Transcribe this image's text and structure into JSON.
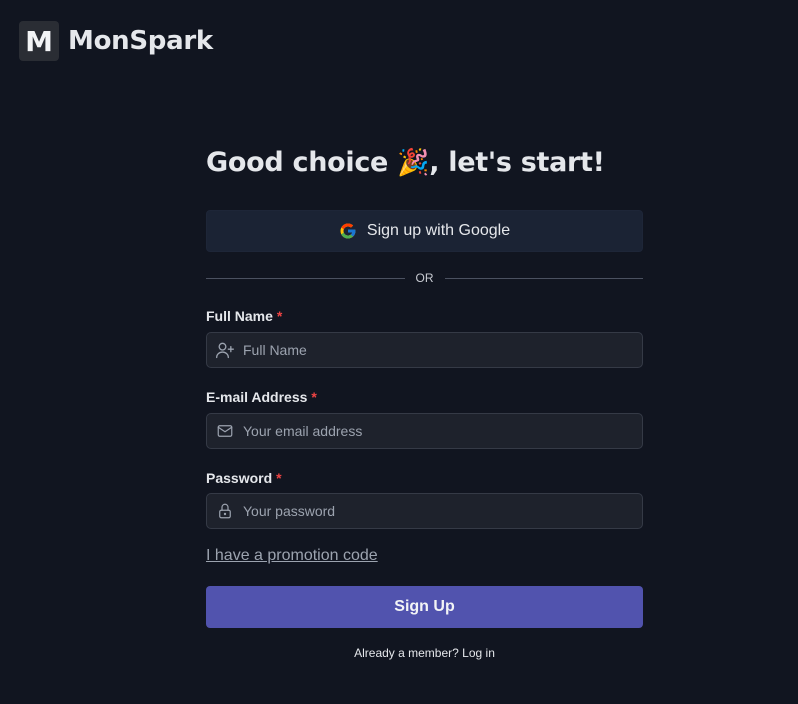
{
  "brand": {
    "mark": "M",
    "name": "MonSpark"
  },
  "heading": {
    "before": "Good choice",
    "emoji": "🎉",
    "after": ", let's start!"
  },
  "google_button": {
    "label": "Sign up with Google",
    "icon": "google-icon"
  },
  "divider": {
    "text": "OR"
  },
  "fields": {
    "full_name": {
      "label": "Full Name",
      "required_mark": "*",
      "placeholder": "Full Name",
      "value": "",
      "icon": "user-add-icon"
    },
    "email": {
      "label": "E-mail Address",
      "required_mark": "*",
      "placeholder": "Your email address",
      "value": "",
      "icon": "mail-icon"
    },
    "password": {
      "label": "Password",
      "required_mark": "*",
      "placeholder": "Your password",
      "value": "",
      "icon": "lock-icon"
    }
  },
  "promo_link": "I have a promotion code",
  "signup_button": "Sign Up",
  "footer": {
    "prompt": "Already a member?",
    "login_link": "Log in"
  },
  "colors": {
    "background": "#111520",
    "primary_button": "#5153ae",
    "input_bg": "#1e222c",
    "required": "#ef4444"
  }
}
